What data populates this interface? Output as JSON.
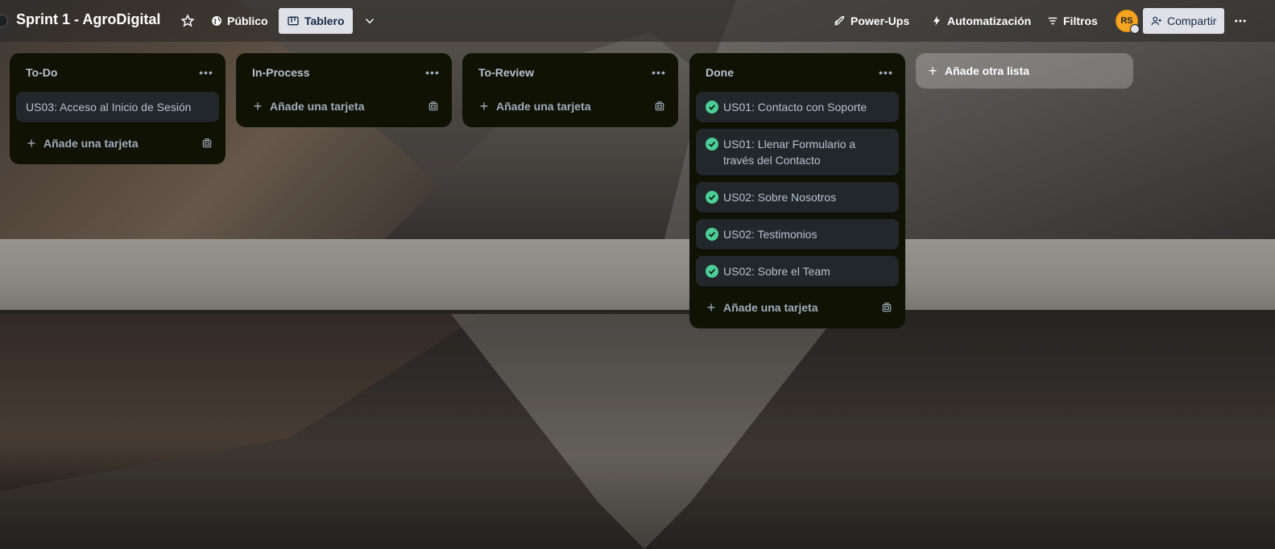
{
  "board": {
    "title": "Sprint 1 - AgroDigital",
    "visibility": "Público",
    "view": "Tablero"
  },
  "header": {
    "powerups": "Power-Ups",
    "automation": "Automatización",
    "filters": "Filtros",
    "avatar_initials": "RS",
    "share": "Compartir"
  },
  "lists": [
    {
      "title": "To-Do",
      "cards": [
        "US03: Acceso al Inicio de Sesión"
      ],
      "add_card": "Añade una tarjeta"
    },
    {
      "title": "In-Process",
      "cards": [],
      "add_card": "Añade una tarjeta"
    },
    {
      "title": "To-Review",
      "cards": [],
      "add_card": "Añade una tarjeta"
    },
    {
      "title": "Done",
      "cards": [
        "US01: Contacto con Soporte",
        "US01: Llenar Formulario a través del Contacto",
        "US02: Sobre Nosotros",
        "US02: Testimonios",
        "US02: Sobre el Team"
      ],
      "add_card": "Añade una tarjeta"
    }
  ],
  "add_list": "Añade otra lista",
  "colors": {
    "list_bg": "#101204",
    "card_bg": "#22272b",
    "done_check": "#4bce97",
    "avatar": "#f6a322"
  }
}
